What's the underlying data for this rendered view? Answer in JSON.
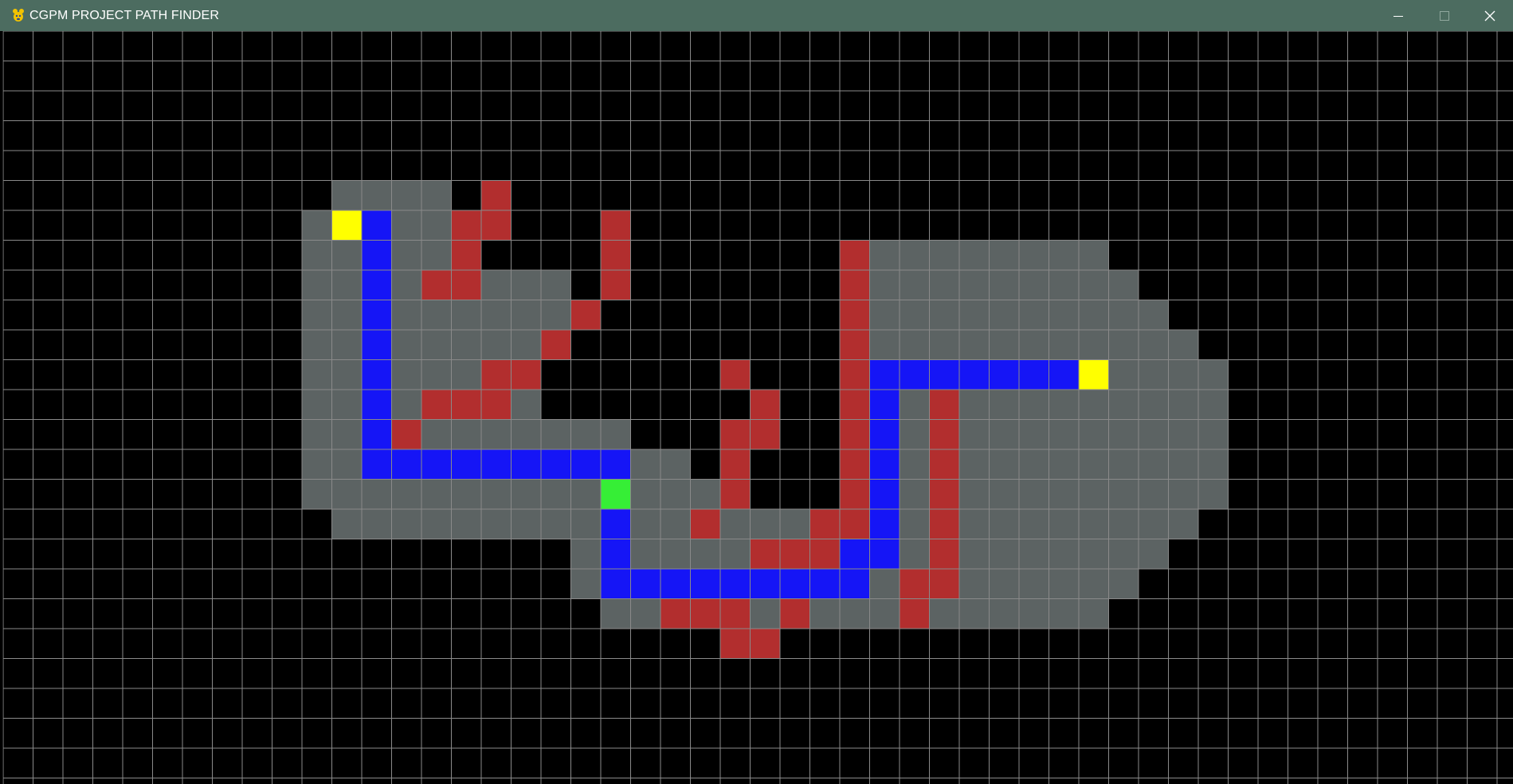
{
  "window": {
    "title": "CGPM PROJECT PATH FINDER",
    "icon": "python-pygame-icon",
    "controls": [
      "minimize-icon",
      "maximize-icon",
      "close-icon"
    ]
  },
  "colors": {
    "titlebar": "#4c6c60",
    "empty": "#000000",
    "grid_line": "#8a8a8a",
    "closed": "#5c6363",
    "barrier": "#b22e2e",
    "path": "#1515f6",
    "start": "#36ee36",
    "end": "#ffff00"
  },
  "grid": {
    "cols": 51,
    "rows": 26,
    "barrier": [
      [
        16,
        5
      ],
      [
        15,
        6
      ],
      [
        16,
        6
      ],
      [
        15,
        7
      ],
      [
        14,
        8
      ],
      [
        15,
        8
      ],
      [
        16,
        11
      ],
      [
        17,
        11
      ],
      [
        14,
        12
      ],
      [
        15,
        12
      ],
      [
        16,
        12
      ],
      [
        13,
        13
      ],
      [
        19,
        9
      ],
      [
        18,
        10
      ],
      [
        20,
        6
      ],
      [
        20,
        7
      ],
      [
        20,
        8
      ],
      [
        24,
        11
      ],
      [
        25,
        12
      ],
      [
        24,
        13
      ],
      [
        25,
        13
      ],
      [
        24,
        14
      ],
      [
        24,
        15
      ],
      [
        23,
        16
      ],
      [
        25,
        17
      ],
      [
        26,
        17
      ],
      [
        27,
        17
      ],
      [
        27,
        16
      ],
      [
        28,
        7
      ],
      [
        28,
        8
      ],
      [
        28,
        9
      ],
      [
        28,
        10
      ],
      [
        28,
        11
      ],
      [
        28,
        12
      ],
      [
        28,
        13
      ],
      [
        28,
        14
      ],
      [
        28,
        15
      ],
      [
        28,
        16
      ],
      [
        31,
        12
      ],
      [
        31,
        13
      ],
      [
        31,
        14
      ],
      [
        31,
        15
      ],
      [
        31,
        16
      ],
      [
        31,
        17
      ],
      [
        30,
        18
      ],
      [
        31,
        18
      ],
      [
        22,
        19
      ],
      [
        23,
        19
      ],
      [
        24,
        19
      ],
      [
        26,
        19
      ],
      [
        30,
        19
      ],
      [
        24,
        20
      ],
      [
        25,
        20
      ]
    ],
    "path": [
      [
        12,
        6
      ],
      [
        12,
        7
      ],
      [
        12,
        8
      ],
      [
        12,
        9
      ],
      [
        12,
        10
      ],
      [
        12,
        11
      ],
      [
        12,
        12
      ],
      [
        12,
        13
      ],
      [
        12,
        14
      ],
      [
        13,
        14
      ],
      [
        14,
        14
      ],
      [
        15,
        14
      ],
      [
        16,
        14
      ],
      [
        17,
        14
      ],
      [
        18,
        14
      ],
      [
        19,
        14
      ],
      [
        20,
        14
      ],
      [
        20,
        16
      ],
      [
        20,
        17
      ],
      [
        20,
        18
      ],
      [
        21,
        18
      ],
      [
        22,
        18
      ],
      [
        23,
        18
      ],
      [
        24,
        18
      ],
      [
        25,
        18
      ],
      [
        26,
        18
      ],
      [
        27,
        18
      ],
      [
        28,
        18
      ],
      [
        28,
        17
      ],
      [
        29,
        17
      ],
      [
        29,
        11
      ],
      [
        29,
        12
      ],
      [
        29,
        13
      ],
      [
        29,
        14
      ],
      [
        29,
        15
      ],
      [
        29,
        16
      ],
      [
        30,
        11
      ],
      [
        31,
        11
      ],
      [
        32,
        11
      ],
      [
        33,
        11
      ],
      [
        34,
        11
      ],
      [
        35,
        11
      ]
    ],
    "start": [
      [
        20,
        15
      ]
    ],
    "end": [
      [
        11,
        6
      ],
      [
        36,
        11
      ]
    ],
    "closed_ranges": [
      [
        5,
        11,
        14
      ],
      [
        6,
        10,
        14
      ],
      [
        7,
        10,
        14
      ],
      [
        7,
        29,
        36
      ],
      [
        8,
        10,
        18
      ],
      [
        8,
        29,
        37
      ],
      [
        9,
        10,
        18
      ],
      [
        9,
        29,
        38
      ],
      [
        10,
        10,
        17
      ],
      [
        10,
        29,
        39
      ],
      [
        11,
        10,
        17
      ],
      [
        11,
        29,
        40
      ],
      [
        12,
        10,
        17
      ],
      [
        12,
        29,
        40
      ],
      [
        13,
        10,
        20
      ],
      [
        13,
        29,
        40
      ],
      [
        14,
        10,
        22
      ],
      [
        14,
        29,
        40
      ],
      [
        15,
        10,
        24
      ],
      [
        15,
        29,
        40
      ],
      [
        16,
        11,
        26
      ],
      [
        16,
        29,
        39
      ],
      [
        17,
        19,
        29
      ],
      [
        17,
        29,
        38
      ],
      [
        18,
        19,
        37
      ],
      [
        19,
        20,
        36
      ]
    ]
  }
}
